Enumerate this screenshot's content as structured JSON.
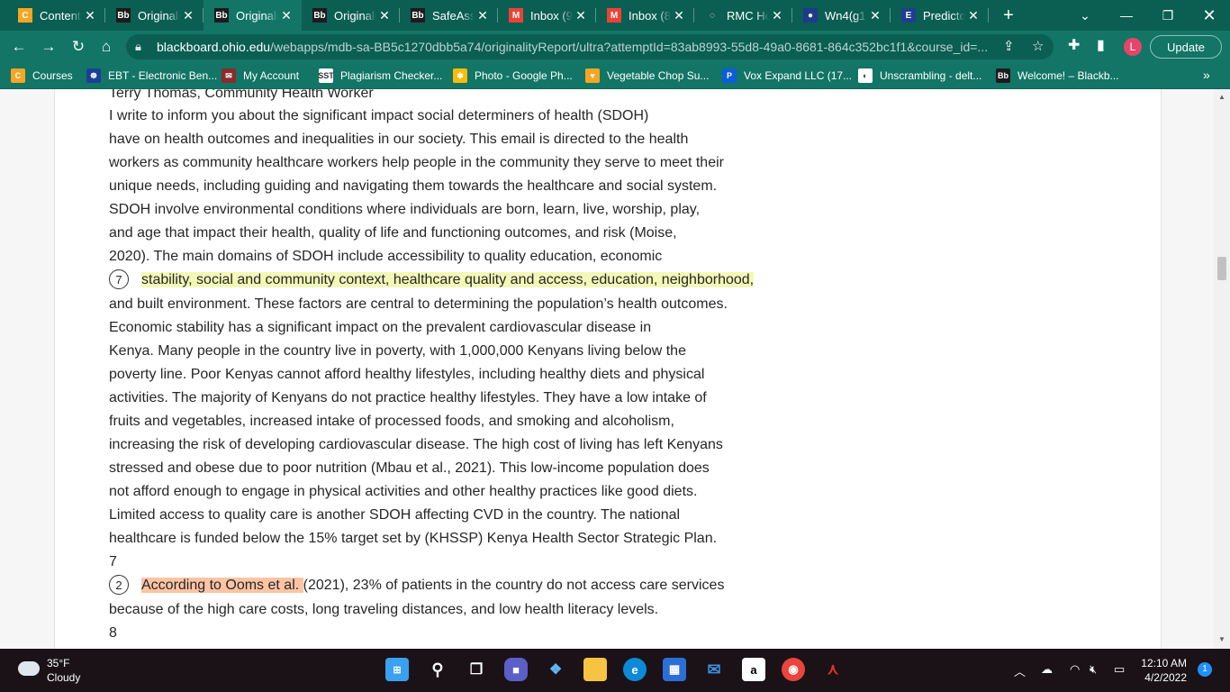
{
  "browser": {
    "tabs": [
      {
        "title": "Content",
        "icon": "C",
        "icon_color": "#f5a623"
      },
      {
        "title": "Originality",
        "icon": "Bb",
        "icon_color": "#1c1c1c"
      },
      {
        "title": "Originality",
        "icon": "Bb",
        "icon_color": "#1c1c1c",
        "active": true
      },
      {
        "title": "Originality",
        "icon": "Bb",
        "icon_color": "#1c1c1c"
      },
      {
        "title": "SafeAssign",
        "icon": "Bb",
        "icon_color": "#1c1c1c"
      },
      {
        "title": "Inbox (9",
        "icon": "M",
        "icon_color": "#ea4335"
      },
      {
        "title": "Inbox (8",
        "icon": "M",
        "icon_color": "#ea4335"
      },
      {
        "title": "RMC Ho",
        "icon": "◌",
        "icon_color": "#0b5e52"
      },
      {
        "title": "Wn4(g1",
        "icon": "●",
        "icon_color": "#1e3a8a"
      },
      {
        "title": "Predicto",
        "icon": "E",
        "icon_color": "#1f3f8f"
      }
    ],
    "url_domain": "blackboard.ohio.edu",
    "url_path": "/webapps/mdb-sa-BB5c1270dbb5a74/originalityReport/ultra?attemptId=83ab8993-55d8-49a0-8681-864c352bc1f1&course_id=...",
    "profile_initial": "L",
    "update_label": "Update",
    "bookmarks": [
      {
        "label": "Courses",
        "icon": "C",
        "icon_color": "#f5a623"
      },
      {
        "label": "EBT - Electronic Ben...",
        "icon": "☸",
        "icon_color": "#1c3f95"
      },
      {
        "label": "My Account",
        "icon": "✉",
        "icon_color": "#8b2b2b"
      },
      {
        "label": "Plagiarism Checker...",
        "icon": "SST",
        "icon_color": "#ffffff"
      },
      {
        "label": "Photo - Google Ph...",
        "icon": "✱",
        "icon_color": "#fbbc04"
      },
      {
        "label": "Vegetable Chop Su...",
        "icon": "♥",
        "icon_color": "#f5a623"
      },
      {
        "label": "Vox Expand LLC (17...",
        "icon": "P",
        "icon_color": "#0c5dd8"
      },
      {
        "label": "Unscrambling - delt...",
        "icon": "◐",
        "icon_color": "#ffffff"
      },
      {
        "label": "Welcome! – Blackb...",
        "icon": "Bb",
        "icon_color": "#1c1c1c"
      }
    ]
  },
  "document": {
    "lines": [
      {
        "text": "Terry Thomas, Community Health Worker",
        "cut": true
      },
      {
        "text": "I write to inform you about the significant impact social determiners of health (SDOH)"
      },
      {
        "text": "have on health outcomes and inequalities in our society. This email is directed to the health"
      },
      {
        "text": "workers as community healthcare workers help people in the community they serve to meet their"
      },
      {
        "text": "unique needs, including guiding and navigating them towards the healthcare and social system."
      },
      {
        "text": "SDOH involve environmental conditions where individuals are born, learn, live, worship, play,"
      },
      {
        "text": "and age that impact their health, quality of life and functioning outcomes, and risk (Moise,"
      },
      {
        "text": "2020). The main domains of SDOH include accessibility to quality education, economic"
      },
      {
        "badge": "7",
        "highlight": "stability, social and community context, healthcare quality and access, education, neighborhood,",
        "highlight_color": "yellow",
        "rest": ""
      },
      {
        "text": "and built environment. These factors are central to determining the population’s health outcomes."
      },
      {
        "text": "Economic stability has a significant impact on the prevalent cardiovascular disease in"
      },
      {
        "text": "Kenya. Many people in the country live in poverty, with 1,000,000 Kenyans living below the"
      },
      {
        "text": "poverty line. Poor Kenyas cannot afford healthy lifestyles, including healthy diets and physical"
      },
      {
        "text": "activities. The majority of Kenyans do not practice healthy lifestyles. They have a low intake of"
      },
      {
        "text": "fruits and vegetables, increased intake of processed foods, and smoking and alcoholism,"
      },
      {
        "text": "increasing the risk of developing cardiovascular disease. The high cost of living has left Kenyans"
      },
      {
        "text": "stressed and obese due to poor nutrition (Mbau et al., 2021). This low-income population does"
      },
      {
        "text": "not afford enough to engage in physical activities and other healthy practices like good diets."
      },
      {
        "text": "Limited access to quality care is another SDOH affecting CVD in the country. The national"
      },
      {
        "text": "healthcare is funded below the 15% target set by (KHSSP) Kenya Health Sector Strategic Plan."
      },
      {
        "text": "7"
      },
      {
        "badge": "2",
        "highlight": "According to Ooms et al. ",
        "highlight_color": "orange",
        "rest": "(2021), 23% of patients in the country do not access care services"
      },
      {
        "text": "because of the high care costs, long traveling distances, and low health literacy levels."
      },
      {
        "text": "8"
      }
    ]
  },
  "taskbar": {
    "temperature": "35°F",
    "condition": "Cloudy",
    "time": "12:10 AM",
    "date": "4/2/2022",
    "notification_count": "1"
  }
}
